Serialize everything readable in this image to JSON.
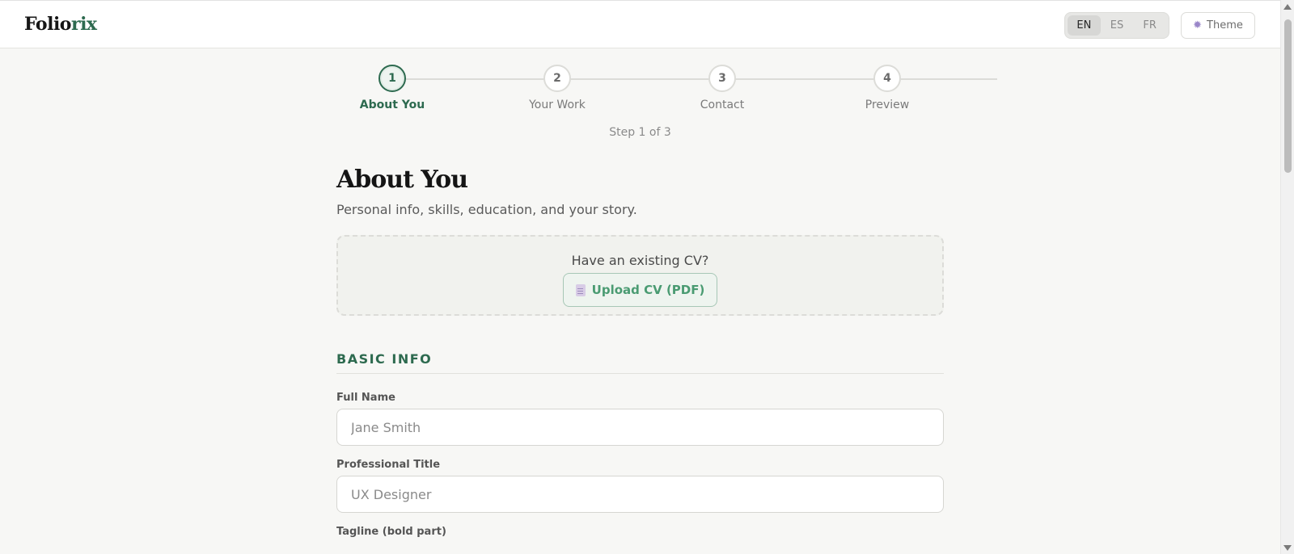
{
  "header": {
    "logo_main": "Folio",
    "logo_accent": "rix",
    "languages": [
      "EN",
      "ES",
      "FR"
    ],
    "active_language": "EN",
    "theme_label": "Theme"
  },
  "stepper": {
    "steps": [
      {
        "number": "1",
        "label": "About You"
      },
      {
        "number": "2",
        "label": "Your Work"
      },
      {
        "number": "3",
        "label": "Contact"
      },
      {
        "number": "4",
        "label": "Preview"
      }
    ],
    "current_step": 1,
    "progress_text": "Step 1 of 3"
  },
  "main": {
    "title": "About You",
    "subtitle": "Personal info, skills, education, and your story.",
    "cv_prompt": "Have an existing CV?",
    "upload_label": "Upload CV (PDF)",
    "section_title": "BASIC INFO",
    "fields": [
      {
        "label": "Full Name",
        "placeholder": "Jane Smith",
        "value": ""
      },
      {
        "label": "Professional Title",
        "placeholder": "UX Designer",
        "value": ""
      },
      {
        "label": "Tagline (bold part)"
      }
    ]
  },
  "colors": {
    "accent": "#2d6a4f",
    "accent_light": "#4a9b72",
    "background": "#f7f7f5"
  }
}
